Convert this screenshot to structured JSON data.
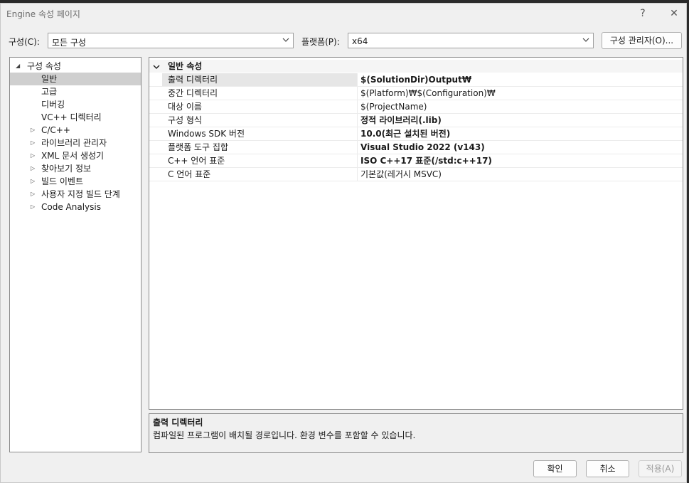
{
  "window": {
    "title": "Engine 속성 페이지",
    "help_glyph": "?",
    "close_glyph": "✕"
  },
  "config": {
    "config_label": "구성(C):",
    "config_value": "모든 구성",
    "platform_label": "플랫폼(P):",
    "platform_value": "x64",
    "manager_button": "구성 관리자(O)..."
  },
  "tree": {
    "root": "구성 속성",
    "items": [
      {
        "label": "일반",
        "selected": true,
        "expandable": false
      },
      {
        "label": "고급",
        "expandable": false
      },
      {
        "label": "디버깅",
        "expandable": false
      },
      {
        "label": "VC++ 디렉터리",
        "expandable": false
      },
      {
        "label": "C/C++",
        "expandable": true
      },
      {
        "label": "라이브러리 관리자",
        "expandable": true
      },
      {
        "label": "XML 문서 생성기",
        "expandable": true
      },
      {
        "label": "찾아보기 정보",
        "expandable": true
      },
      {
        "label": "빌드 이벤트",
        "expandable": true
      },
      {
        "label": "사용자 지정 빌드 단계",
        "expandable": true
      },
      {
        "label": "Code Analysis",
        "expandable": true
      }
    ]
  },
  "grid": {
    "category": "일반 속성",
    "rows": [
      {
        "name": "출력 디렉터리",
        "value": "$(SolutionDir)Output₩",
        "bold": true,
        "selected": true
      },
      {
        "name": "중간 디렉터리",
        "value": "$(Platform)₩$(Configuration)₩",
        "bold": false
      },
      {
        "name": "대상 이름",
        "value": "$(ProjectName)",
        "bold": false
      },
      {
        "name": "구성 형식",
        "value": "정적 라이브러리(.lib)",
        "bold": true
      },
      {
        "name": "Windows SDK 버전",
        "value": "10.0(최근 설치된 버전)",
        "bold": true
      },
      {
        "name": "플랫폼 도구 집합",
        "value": "Visual Studio 2022 (v143)",
        "bold": true
      },
      {
        "name": "C++ 언어 표준",
        "value": "ISO C++17 표준(/std:c++17)",
        "bold": true
      },
      {
        "name": "C 언어 표준",
        "value": "기본값(레거시 MSVC)",
        "bold": false
      }
    ]
  },
  "description": {
    "title": "출력 디렉터리",
    "text": "컴파일된 프로그램이 배치될 경로입니다. 환경 변수를 포함할 수 있습니다."
  },
  "buttons": {
    "ok": "확인",
    "cancel": "취소",
    "apply": "적용(A)"
  }
}
